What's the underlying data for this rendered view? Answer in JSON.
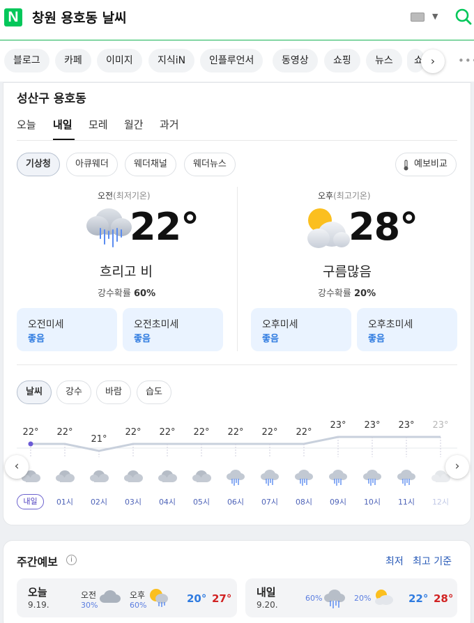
{
  "header": {
    "query": "창원 용호동 날씨",
    "logo_letter": "N",
    "brand_color": "#03c75a"
  },
  "tabs": [
    "블로그",
    "카페",
    "이미지",
    "지식iN",
    "인플루언서",
    "동영상",
    "쇼핑",
    "뉴스",
    "쇼"
  ],
  "weather": {
    "location": "성산구 용호동",
    "subtabs": [
      "오늘",
      "내일",
      "모레",
      "월간",
      "과거"
    ],
    "active_subtab": "내일",
    "providers": [
      "기상청",
      "아큐웨더",
      "웨더채널",
      "웨더뉴스"
    ],
    "compare_label": "예보비교",
    "am": {
      "label": "오전",
      "sublabel": "(최저기온)",
      "temp": "22°",
      "condition": "흐리고 비",
      "rain_label": "강수확률",
      "rain": "60%",
      "icon": "cloud-rain-icon"
    },
    "pm": {
      "label": "오후",
      "sublabel": "(최고기온)",
      "temp": "28°",
      "condition": "구름많음",
      "rain_label": "강수확률",
      "rain": "20%",
      "icon": "sun-cloud-icon"
    },
    "dust": [
      {
        "title": "오전미세",
        "value": "좋음"
      },
      {
        "title": "오전초미세",
        "value": "좋음"
      },
      {
        "title": "오후미세",
        "value": "좋음"
      },
      {
        "title": "오후초미세",
        "value": "좋음"
      }
    ],
    "chart_tabs": [
      "날씨",
      "강수",
      "바람",
      "습도"
    ],
    "hourly": [
      {
        "time": "내일",
        "temp": "22°",
        "icon": "cloud-icon"
      },
      {
        "time": "01시",
        "temp": "22°",
        "icon": "cloud-icon"
      },
      {
        "time": "02시",
        "temp": "21°",
        "icon": "cloud-icon"
      },
      {
        "time": "03시",
        "temp": "22°",
        "icon": "cloud-icon"
      },
      {
        "time": "04시",
        "temp": "22°",
        "icon": "cloud-icon"
      },
      {
        "time": "05시",
        "temp": "22°",
        "icon": "cloud-icon"
      },
      {
        "time": "06시",
        "temp": "22°",
        "icon": "rain-icon"
      },
      {
        "time": "07시",
        "temp": "22°",
        "icon": "rain-icon"
      },
      {
        "time": "08시",
        "temp": "22°",
        "icon": "rain-icon"
      },
      {
        "time": "09시",
        "temp": "23°",
        "icon": "rain-icon"
      },
      {
        "time": "10시",
        "temp": "23°",
        "icon": "rain-icon"
      },
      {
        "time": "11시",
        "temp": "23°",
        "icon": "rain-icon"
      },
      {
        "time": "12시",
        "temp": "23°",
        "icon": "cloud-icon"
      }
    ]
  },
  "weekly": {
    "title": "주간예보",
    "sort_options": [
      "최저",
      "최고 기준"
    ],
    "days": [
      {
        "name": "오늘",
        "date": "9.19.",
        "am_label": "오전",
        "am_rain": "30%",
        "pm_label": "오후",
        "pm_rain": "60%",
        "low": "20°",
        "high": "27°"
      },
      {
        "name": "내일",
        "date": "9.20.",
        "am_rain": "60%",
        "pm_rain": "20%",
        "low": "22°",
        "high": "28°"
      }
    ]
  }
}
